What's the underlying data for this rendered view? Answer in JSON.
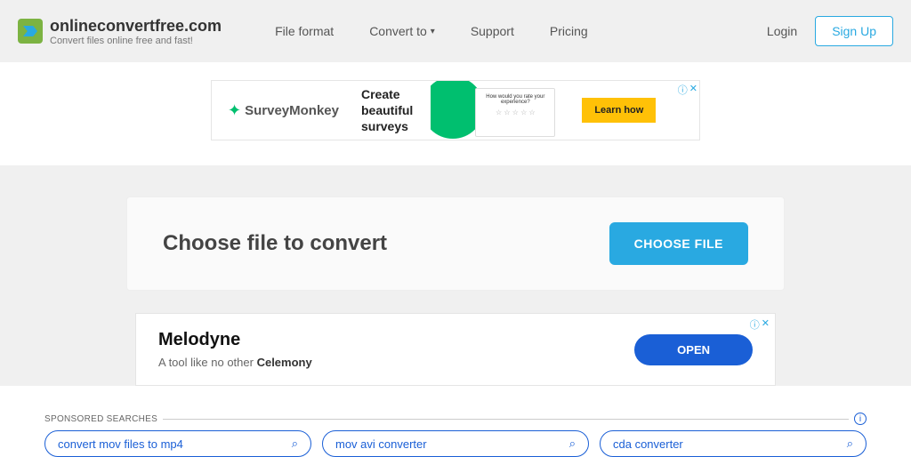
{
  "brand": {
    "name": "onlineconvertfree.com",
    "tagline": "Convert files online free and fast!"
  },
  "nav": {
    "file_format": "File format",
    "convert_to": "Convert to",
    "support": "Support",
    "pricing": "Pricing"
  },
  "auth": {
    "login": "Login",
    "signup": "Sign Up"
  },
  "ad1": {
    "brand": "SurveyMonkey",
    "text_l1": "Create",
    "text_l2": "beautiful",
    "text_l3": "surveys",
    "card_text": "How would you rate your experience?",
    "cta": "Learn how"
  },
  "upload": {
    "title": "Choose file to convert",
    "button": "CHOOSE FILE"
  },
  "ad2": {
    "title": "Melodyne",
    "sub_prefix": "A tool like no other ",
    "sub_brand": "Celemony",
    "cta": "OPEN"
  },
  "sponsored": {
    "label": "SPONSORED SEARCHES",
    "links": [
      "convert mov files to mp4",
      "mov avi converter",
      "cda converter"
    ]
  }
}
